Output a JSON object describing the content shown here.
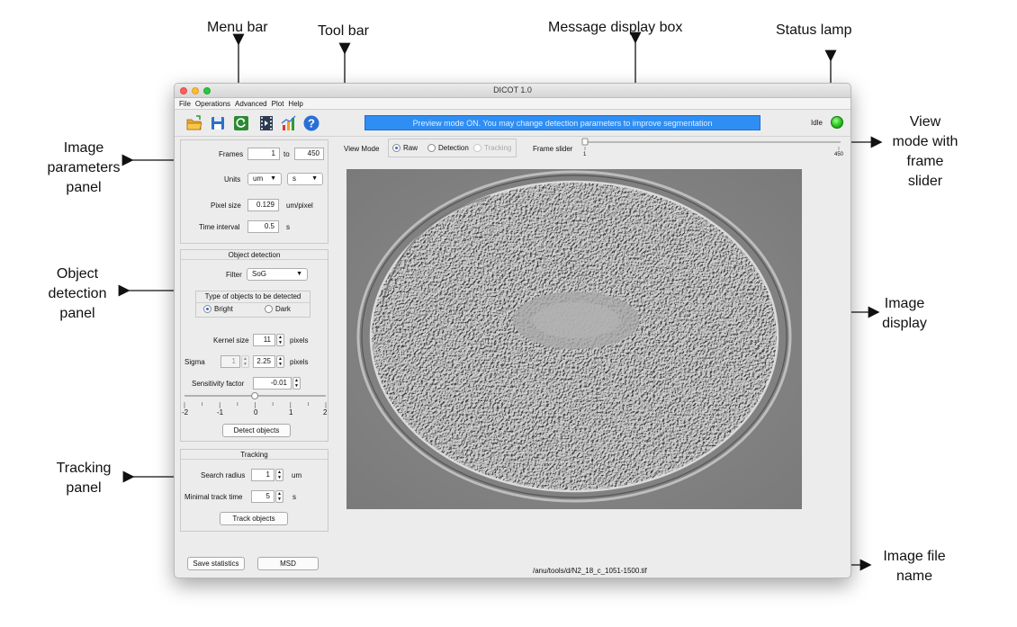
{
  "annotations": {
    "menu_bar": "Menu bar",
    "tool_bar": "Tool bar",
    "message_display_box": "Message display box",
    "status_lamp": "Status lamp",
    "image_parameters_panel": [
      "Image",
      "parameters",
      "panel"
    ],
    "view_mode_with_frame_slider": [
      "View",
      "mode with",
      "frame",
      "slider"
    ],
    "object_detection_panel": [
      "Object",
      "detection",
      "panel"
    ],
    "image_display": [
      "Image",
      "display"
    ],
    "tracking_panel": [
      "Tracking",
      "panel"
    ],
    "image_file_name": [
      "Image file",
      "name"
    ]
  },
  "window": {
    "title": "DICOT 1.0",
    "menu": [
      "File",
      "Operations",
      "Advanced",
      "Plot",
      "Help"
    ],
    "toolbar_icons": [
      "open-folder-icon",
      "save-icon",
      "refresh-icon",
      "movie-icon",
      "chart-icon",
      "help-icon"
    ],
    "message": "Preview mode ON. You may change detection parameters to improve segmentation",
    "status_label": "Idle",
    "status_lamp_color": "#22c21a",
    "message_color": "#2f8ef3"
  },
  "image_params": {
    "frames_label": "Frames",
    "frames_from": "1",
    "to_label": "to",
    "frames_to": "450",
    "units_label": "Units",
    "unit_space": "um",
    "unit_time": "s",
    "pixel_size_label": "Pixel size",
    "pixel_size": "0.129",
    "pixel_unit": "um/pixel",
    "time_interval_label": "Time interval",
    "time_interval": "0.5",
    "time_unit": "s"
  },
  "object_detection": {
    "title": "Object detection",
    "filter_label": "Filter",
    "filter_value": "SoG",
    "type_title": "Type of objects to be detected",
    "bright_label": "Bright",
    "dark_label": "Dark",
    "selected_type": "Bright",
    "kernel_label": "Kernel size",
    "kernel_value": "11",
    "kernel_unit": "pixels",
    "sigma_label": "Sigma",
    "sigma_disabled_value": "1",
    "sigma_value": "2.25",
    "sigma_unit": "pixels",
    "sensitivity_label": "Sensitivity factor",
    "sensitivity_value": "-0.01",
    "slider_ticks": [
      "-2",
      "-1",
      "0",
      "1",
      "2"
    ],
    "slider_value": -0.01,
    "detect_button": "Detect objects"
  },
  "tracking": {
    "title": "Tracking",
    "search_radius_label": "Search radius",
    "search_radius": "1",
    "search_radius_unit": "um",
    "min_track_label": "Minimal track time",
    "min_track_value": "5",
    "min_track_unit": "s",
    "track_button": "Track objects"
  },
  "bottom": {
    "save_stats_button": "Save statistics",
    "msd_button": "MSD",
    "file_path": "/anu/tools/d/N2_18_c_1051-1500.tif"
  },
  "view_mode": {
    "label": "View Mode",
    "options": [
      "Raw",
      "Detection",
      "Tracking"
    ],
    "selected": "Raw",
    "frame_slider_label": "Frame slider",
    "slider_min": "1",
    "slider_max": "450",
    "slider_value": 1
  }
}
